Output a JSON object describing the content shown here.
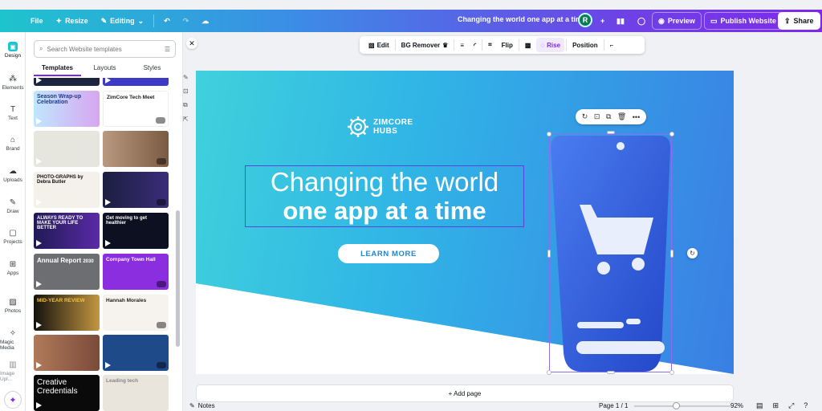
{
  "topbar": {
    "file": "File",
    "resize": "Resize",
    "editing": "Editing",
    "doc_title": "Changing the world one app at a time",
    "avatar_initial": "R",
    "preview": "Preview",
    "publish": "Publish Website",
    "share": "Share"
  },
  "rail": {
    "items": [
      {
        "label": "Design",
        "icon": "design-icon"
      },
      {
        "label": "Elements",
        "icon": "elements-icon"
      },
      {
        "label": "Text",
        "icon": "text-icon"
      },
      {
        "label": "Brand",
        "icon": "brand-icon"
      },
      {
        "label": "Uploads",
        "icon": "uploads-icon"
      },
      {
        "label": "Draw",
        "icon": "draw-icon"
      },
      {
        "label": "Projects",
        "icon": "projects-icon"
      },
      {
        "label": "Apps",
        "icon": "apps-icon"
      },
      {
        "label": "Photos",
        "icon": "photos-icon"
      },
      {
        "label": "Magic Media",
        "icon": "magic-media-icon"
      },
      {
        "label": "Image Upl...",
        "icon": "image-upload-icon"
      }
    ]
  },
  "panel": {
    "search_placeholder": "Search Website templates",
    "tabs": [
      "Templates",
      "Layouts",
      "Styles"
    ],
    "thumb_texts": {
      "t1": "Season Wrap-up Celebration",
      "t2": "ZimCore Tech Meet",
      "t5": "PHOTO-GRAPHS",
      "t5b": "by Debra Butler",
      "t7": "ALWAYS READY TO MAKE YOUR LIFE BETTER",
      "t8": "Get moving to get healthier",
      "t9": "Annual Report",
      "t9b": "2030",
      "t10": "Company Town Hall",
      "t11": "MID-YEAR REVIEW",
      "t12": "Hannah Morales",
      "t15": "Creative Credentials",
      "t16": "Leading tech"
    }
  },
  "context_toolbar": {
    "edit": "Edit",
    "bg_remover": "BG Remover",
    "flip": "Flip",
    "rise": "Rise",
    "position": "Position"
  },
  "design": {
    "logo_line1": "ZIMCORE",
    "logo_line2": "HUBS",
    "heading_line1": "Changing the world",
    "heading_line2": "one app at a time",
    "cta": "LEARN MORE"
  },
  "footer": {
    "add_page": "+ Add page",
    "notes": "Notes",
    "page_info": "Page 1 / 1",
    "zoom": "92%",
    "zoom_level": 0.43
  },
  "colors": {
    "brand_purple": "#7d2ae8",
    "design_cyan": "#3fd1dc",
    "design_blue": "#3a7fe4",
    "phone_blue": "#2f5fe0"
  }
}
